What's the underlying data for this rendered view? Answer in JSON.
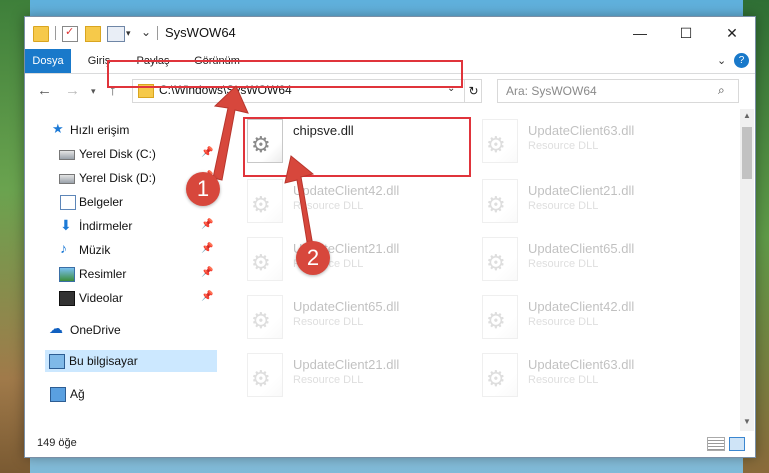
{
  "window": {
    "title": "SysWOW64",
    "minimize": "—",
    "maximize": "☐",
    "close": "✕"
  },
  "ribbon": {
    "tabs": [
      "Dosya",
      "Giriş",
      "Paylaş",
      "Görünüm"
    ],
    "help": "?"
  },
  "address": {
    "path": "C:\\Windows\\SysWOW64",
    "search_placeholder": "Ara: SysWOW64"
  },
  "nav": {
    "items": [
      {
        "label": "Hızlı erişim",
        "icon": "star-icon"
      },
      {
        "label": "Yerel Disk (C:)",
        "icon": "drive-icon",
        "pinned": true
      },
      {
        "label": "Yerel Disk (D:)",
        "icon": "drive-icon",
        "pinned": true
      },
      {
        "label": "Belgeler",
        "icon": "documents-icon",
        "pinned": true
      },
      {
        "label": "İndirmeler",
        "icon": "download-icon",
        "pinned": true
      },
      {
        "label": "Müzik",
        "icon": "music-icon",
        "pinned": true
      },
      {
        "label": "Resimler",
        "icon": "pictures-icon",
        "pinned": true
      },
      {
        "label": "Videolar",
        "icon": "video-icon",
        "pinned": true
      },
      {
        "label": "OneDrive",
        "icon": "cloud-icon"
      },
      {
        "label": "Bu bilgisayar",
        "icon": "computer-icon",
        "selected": true
      },
      {
        "label": "Ağ",
        "icon": "network-icon"
      }
    ]
  },
  "files": [
    {
      "name": "chipsve.dll",
      "type": "",
      "faded": false
    },
    {
      "name": "UpdateClient63.dll",
      "type": "Resource DLL",
      "faded": true
    },
    {
      "name": "UpdateClient42.dll",
      "type": "Resource DLL",
      "faded": true
    },
    {
      "name": "UpdateClient21.dll",
      "type": "Resource DLL",
      "faded": true
    },
    {
      "name": "UpdateClient21.dll",
      "type": "Resource DLL",
      "faded": true
    },
    {
      "name": "UpdateClient65.dll",
      "type": "Resource DLL",
      "faded": true
    },
    {
      "name": "UpdateClient65.dll",
      "type": "Resource DLL",
      "faded": true
    },
    {
      "name": "UpdateClient42.dll",
      "type": "Resource DLL",
      "faded": true
    },
    {
      "name": "UpdateClient21.dll",
      "type": "Resource DLL",
      "faded": true
    },
    {
      "name": "UpdateClient63.dll",
      "type": "Resource DLL",
      "faded": true
    }
  ],
  "status": {
    "count": "149 öğe"
  },
  "callouts": {
    "one": "1",
    "two": "2",
    "color": "#d7473c"
  }
}
